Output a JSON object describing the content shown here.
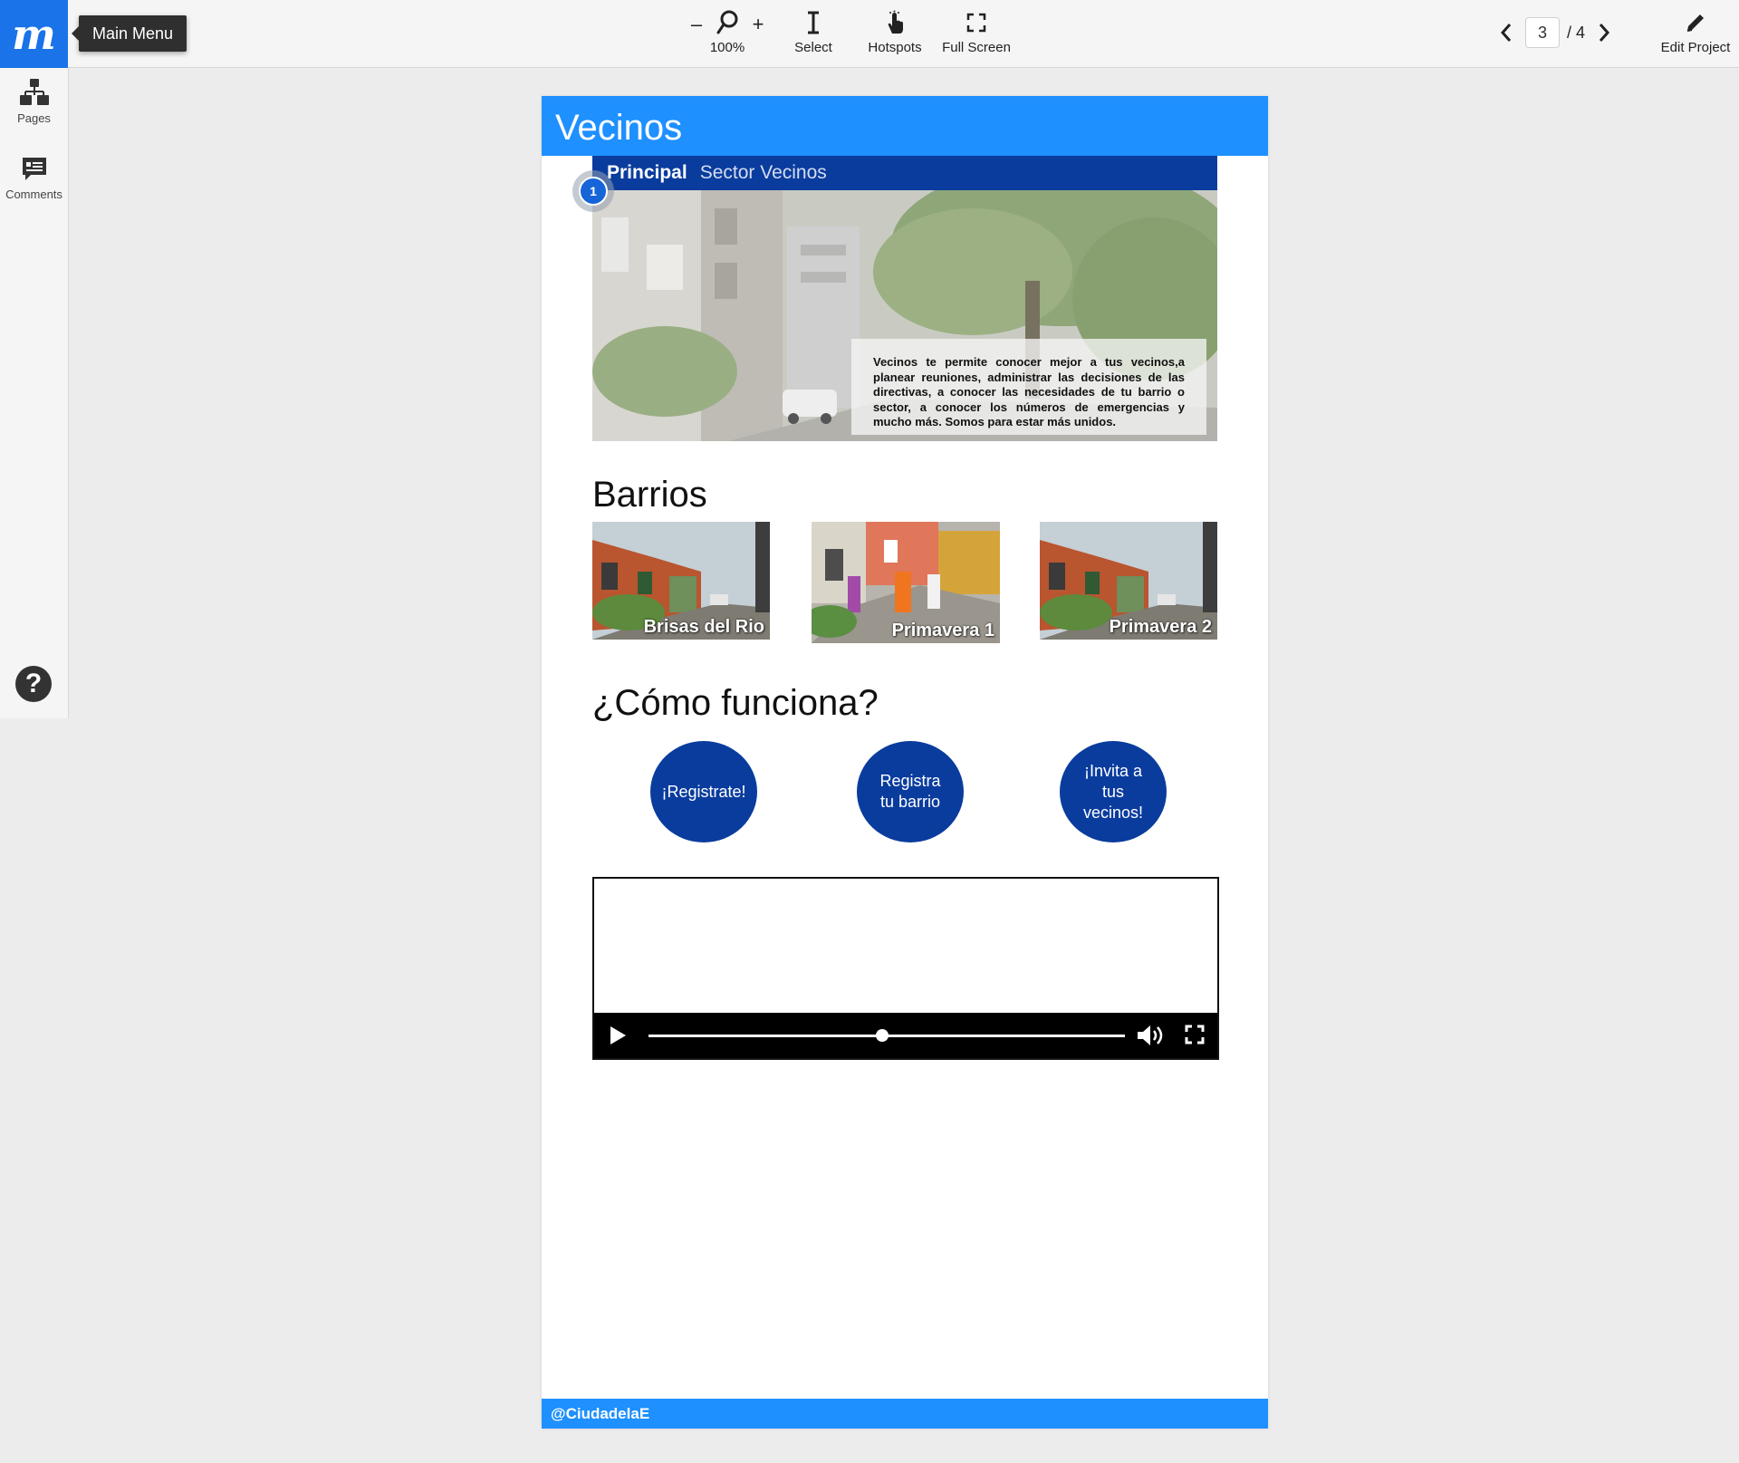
{
  "app": {
    "logo_letter": "m",
    "tooltip": "Main Menu"
  },
  "toolbar": {
    "zoom_out": "–",
    "zoom_in": "+",
    "zoom_level": "100%",
    "select_label": "Select",
    "hotspots_label": "Hotspots",
    "fullscreen_label": "Full Screen",
    "edit_label": "Edit Project"
  },
  "pager": {
    "current_page": "3",
    "total": "/ 4"
  },
  "sidebar": {
    "pages_label": "Pages",
    "comments_label": "Comments",
    "help_symbol": "?"
  },
  "prototype": {
    "header_title": "Vecinos",
    "nav": {
      "active": "Principal",
      "link": "Sector Vecinos"
    },
    "hotspot_number": "1",
    "hero_text": "Vecinos te permite conocer mejor a tus vecinos,a planear reuniones, administrar las decisiones de las directivas, a conocer las necesidades de tu barrio o sector, a conocer los números de emergencias y mucho más. Somos para estar más unidos.",
    "barrios_title": "Barrios",
    "barrios": [
      "Brisas del Rio",
      "Primavera 1",
      "Primavera 2"
    ],
    "como_title": "¿Cómo funciona?",
    "steps": [
      "¡Registrate!",
      "Registra tu barrio",
      "¡Invita a tus vecinos!"
    ],
    "video": {
      "progress": 0.49
    },
    "footer": "@CiudadelaE"
  },
  "colors": {
    "brand_blue": "#1a73e8",
    "header_blue": "#1e90ff",
    "nav_navy": "#0a3c9e",
    "circle_navy": "#0a3c9e"
  },
  "icons": {
    "zoom": "magnifier-icon",
    "select": "text-cursor-icon",
    "hotspots": "pointer-hand-icon",
    "fullscreen": "fullscreen-icon",
    "prev": "chevron-left-icon",
    "next": "chevron-right-icon",
    "edit": "pencil-icon",
    "pages": "sitemap-icon",
    "comments": "comment-icon",
    "help": "question-icon"
  }
}
